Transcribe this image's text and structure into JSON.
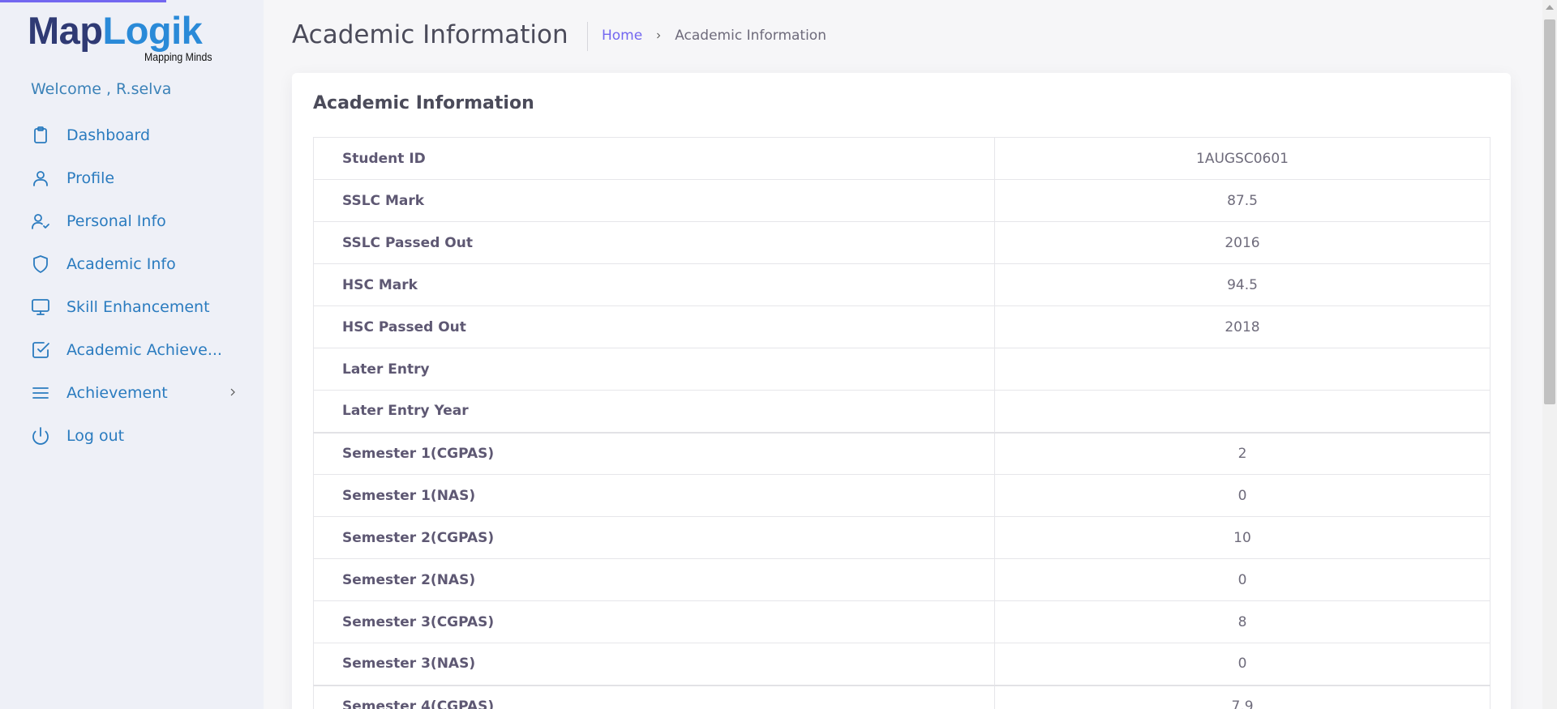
{
  "brand": {
    "logo_part1": "Map",
    "logo_part2": "Logik",
    "tagline": "Mapping Minds",
    "colors": {
      "dark": "#2f3a74",
      "light": "#2a8ad8"
    }
  },
  "sidebar": {
    "welcome": "Welcome , R.selva",
    "items": [
      {
        "label": "Dashboard",
        "icon": "clipboard-icon"
      },
      {
        "label": "Profile",
        "icon": "user-icon"
      },
      {
        "label": "Personal Info",
        "icon": "user-check-icon"
      },
      {
        "label": "Academic Info",
        "icon": "shield-icon"
      },
      {
        "label": "Skill Enhancement",
        "icon": "monitor-icon"
      },
      {
        "label": "Academic Achieve...",
        "icon": "check-square-icon"
      },
      {
        "label": "Achievement",
        "icon": "menu-icon",
        "has_submenu": true
      },
      {
        "label": "Log out",
        "icon": "power-icon"
      }
    ]
  },
  "header": {
    "title": "Academic Information",
    "breadcrumb": {
      "home": "Home",
      "current": "Academic Information"
    }
  },
  "card": {
    "title": "Academic Information",
    "rows": [
      {
        "label": "Student ID",
        "value": "1AUGSC0601"
      },
      {
        "label": "SSLC Mark",
        "value": "87.5"
      },
      {
        "label": "SSLC Passed Out",
        "value": "2016"
      },
      {
        "label": "HSC Mark",
        "value": "94.5"
      },
      {
        "label": "HSC Passed Out",
        "value": "2018"
      },
      {
        "label": "Later Entry",
        "value": ""
      },
      {
        "label": "Later Entry Year",
        "value": ""
      },
      {
        "label": "Semester 1(CGPAS)",
        "value": "2"
      },
      {
        "label": "Semester 1(NAS)",
        "value": "0"
      },
      {
        "label": "Semester 2(CGPAS)",
        "value": "10"
      },
      {
        "label": "Semester 2(NAS)",
        "value": "0"
      },
      {
        "label": "Semester 3(CGPAS)",
        "value": "8"
      },
      {
        "label": "Semester 3(NAS)",
        "value": "0"
      },
      {
        "label": "Semester 4(CGPAS)",
        "value": "7.9"
      }
    ]
  },
  "theme": {
    "accent": "#7367f0",
    "nav_text": "#2a7bbf",
    "sidebar_bg": "#eef0f7"
  }
}
